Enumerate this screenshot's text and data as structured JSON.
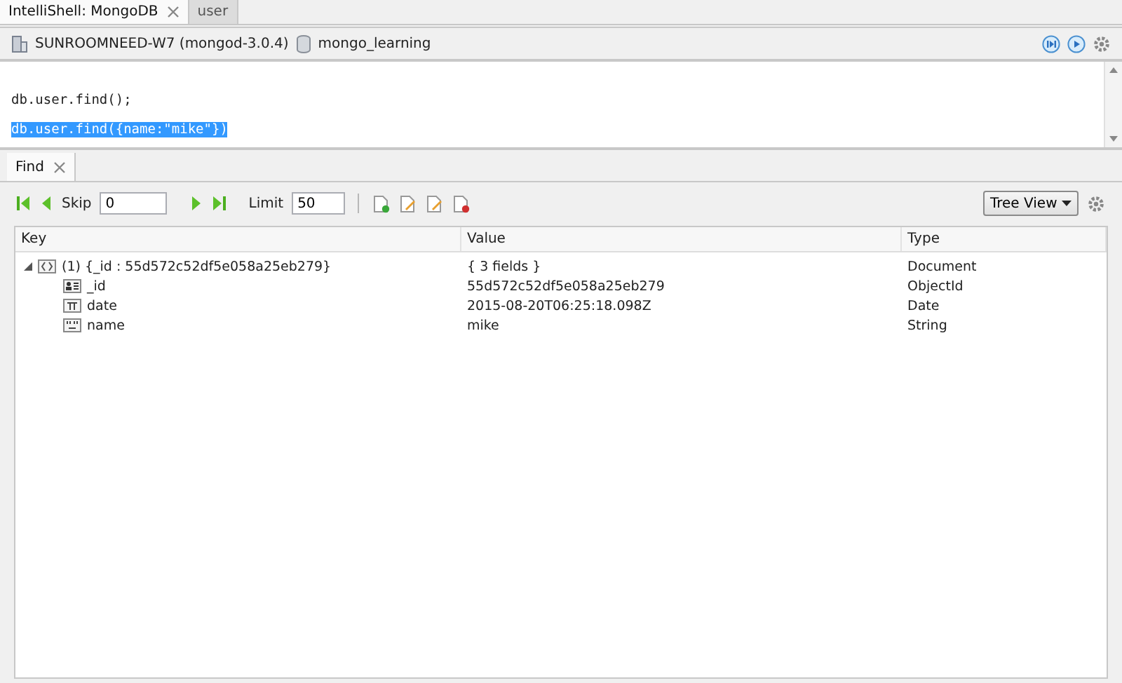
{
  "editor_tabs": [
    {
      "label": "IntelliShell: MongoDB",
      "selected": true,
      "closable": true
    },
    {
      "label": "user",
      "selected": false,
      "closable": false
    }
  ],
  "connection": {
    "server": "SUNROOMNEED-W7 (mongod-3.0.4)",
    "database": "mongo_learning"
  },
  "editor": {
    "lines": [
      {
        "text": "db.user.find();",
        "selected": false
      },
      {
        "text": "db.user.find({name:\"mike\"})",
        "selected": true
      }
    ]
  },
  "result_tabs": [
    {
      "label": "Find",
      "selected": true
    }
  ],
  "toolbar": {
    "skip_label": "Skip",
    "skip_value": "0",
    "limit_label": "Limit",
    "limit_value": "50",
    "view": "Tree View"
  },
  "table": {
    "columns": [
      "Key",
      "Value",
      "Type"
    ],
    "rows": [
      {
        "kind": "document",
        "key": "(1) {_id : 55d572c52df5e058a25eb279}",
        "value": "{ 3 fields }",
        "type": "Document",
        "expanded": true,
        "children": [
          {
            "kind": "objectid",
            "key": "_id",
            "value": "55d572c52df5e058a25eb279",
            "type": "ObjectId"
          },
          {
            "kind": "date",
            "key": "date",
            "value": "2015-08-20T06:25:18.098Z",
            "type": "Date"
          },
          {
            "kind": "string",
            "key": "name",
            "value": "mike",
            "type": "String"
          }
        ]
      }
    ]
  }
}
